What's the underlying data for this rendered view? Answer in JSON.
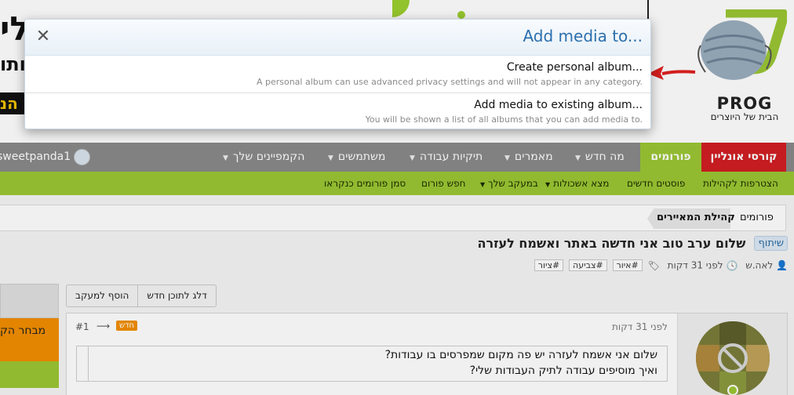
{
  "banner": {
    "big_text_1": "לי",
    "big_text_2": "יותו",
    "strip_text": "הנ"
  },
  "logo": {
    "name": "PROG",
    "tagline": "הבית של היוצרים"
  },
  "nav": {
    "items": [
      {
        "label": "קורסי אונליין"
      },
      {
        "label": "פורומים"
      },
      {
        "label": "מה חדש"
      },
      {
        "label": "מאמרים"
      },
      {
        "label": "תיקיות עבודה"
      },
      {
        "label": "משתמשים"
      },
      {
        "label": "הקמפיינים שלך"
      }
    ],
    "username": "sweetpanda1"
  },
  "subnav": {
    "items": [
      {
        "label": "הצטרפות לקהילות"
      },
      {
        "label": "פוסטים חדשים"
      },
      {
        "label": "מצא אשכולות"
      },
      {
        "label": "במעקב שלך"
      },
      {
        "label": "חפש פורום"
      },
      {
        "label": "סמן פורומים כנקראו"
      }
    ]
  },
  "breadcrumb": {
    "items": [
      {
        "label": "פורומים"
      },
      {
        "label": "קהילת המאיירים"
      }
    ]
  },
  "thread": {
    "prefix": "שיתוף",
    "title": "שלום ערב טוב אני חדשה באתר ואשמח לעזרה",
    "author": "לאה.ש",
    "time": "לפני 31 דקות",
    "tags": [
      "#איור",
      "#צביעה",
      "#ציור"
    ]
  },
  "actions": {
    "skip_label": "דלג לתוכן חדש",
    "watch_label": "הוסף למעקב"
  },
  "sidebar": {
    "orange_text": "מבחר הק"
  },
  "post": {
    "time": "לפני 31 דקות",
    "number": "#1",
    "new_badge": "חדש",
    "line1": "שלום אני אשמח לעזרה יש פה מקום שמפרסים בו עבודות?",
    "line2": "ואיך מוסיפים עבודה לתיק העבודות שלי?"
  },
  "modal": {
    "title": "Add media to...",
    "close_glyph": "✕",
    "options": [
      {
        "label": "Create personal album...",
        "description": "A personal album can use advanced privacy settings and will not appear in any category."
      },
      {
        "label": "Add media to existing album...",
        "description": "You will be shown a list of all albums that you can add media to."
      }
    ]
  },
  "colors": {
    "accent_blue": "#2b6fad",
    "nav_red": "#d11e22",
    "nav_green": "#9bc633",
    "nav_grey": "#8a8a8a",
    "badge_orange": "#f28e00"
  }
}
